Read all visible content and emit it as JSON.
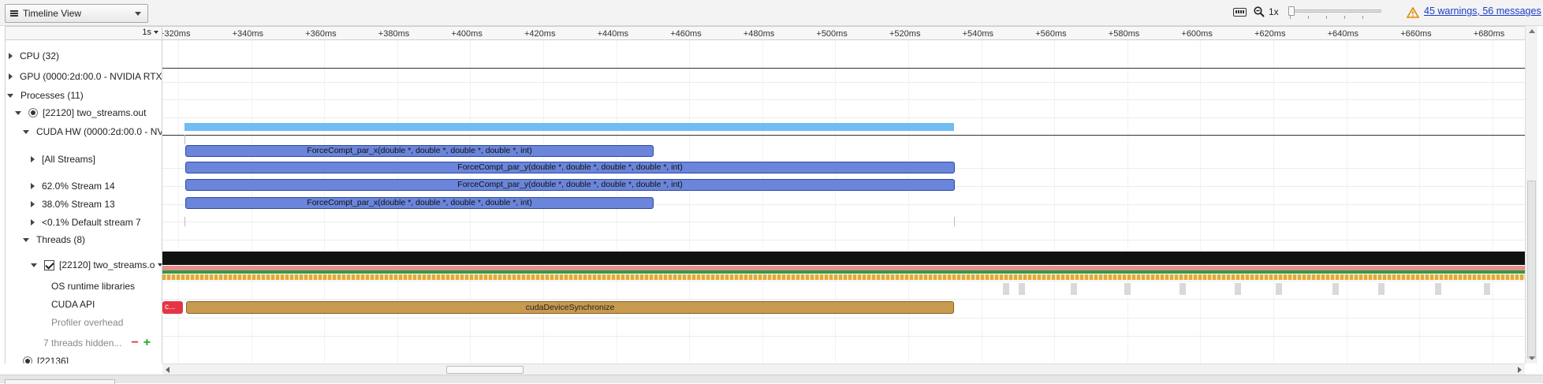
{
  "toolbar": {
    "view_select": "Timeline View",
    "zoom_level": "1x",
    "warnings_link": "45 warnings, 56 messages"
  },
  "ruler": {
    "scale": "1s",
    "ticks": [
      "+320ms",
      "+340ms",
      "+360ms",
      "+380ms",
      "+400ms",
      "+420ms",
      "+440ms",
      "+460ms",
      "+480ms",
      "+500ms",
      "+520ms",
      "+540ms",
      "+560ms",
      "+580ms",
      "+600ms",
      "+620ms",
      "+640ms",
      "+660ms",
      "+680ms"
    ]
  },
  "tree": {
    "cpu": "CPU (32)",
    "gpu": "GPU (0000:2d:00.0 - NVIDIA RTX",
    "processes": "Processes (11)",
    "process": "[22120] two_streams.out",
    "cuda_hw": "CUDA HW (0000:2d:00.0 - NV",
    "all_streams": "[All Streams]",
    "stream14": "62.0% Stream 14",
    "stream13": "38.0% Stream 13",
    "default_stream": "<0.1% Default stream 7",
    "threads": "Threads (8)",
    "thread": "[22120] two_streams.o",
    "os_runtime": "OS runtime libraries",
    "cuda_api": "CUDA API",
    "profiler_overhead": "Profiler overhead",
    "threads_hidden": "7 threads hidden...",
    "next_process": "[22136]"
  },
  "kernels": {
    "all_streams_1": "ForceCompt_par_x(double *, double *, double *, double *, int)",
    "all_streams_2": "ForceCompt_par_y(double *, double *, double *, double *, int)",
    "stream14": "ForceCompt_par_y(double *, double *, double *, double *, int)",
    "stream13": "ForceCompt_par_x(double *, double *, double *, double *, int)"
  },
  "cuda_api": {
    "red_call": "c...",
    "sync_call": "cudaDeviceSynchronize"
  },
  "colors": {
    "kernel": "#6a85d9",
    "hw_bar": "#6fbdf2",
    "cuda_sync": "#c89a4f",
    "warning_link": "#1a3ec8"
  }
}
